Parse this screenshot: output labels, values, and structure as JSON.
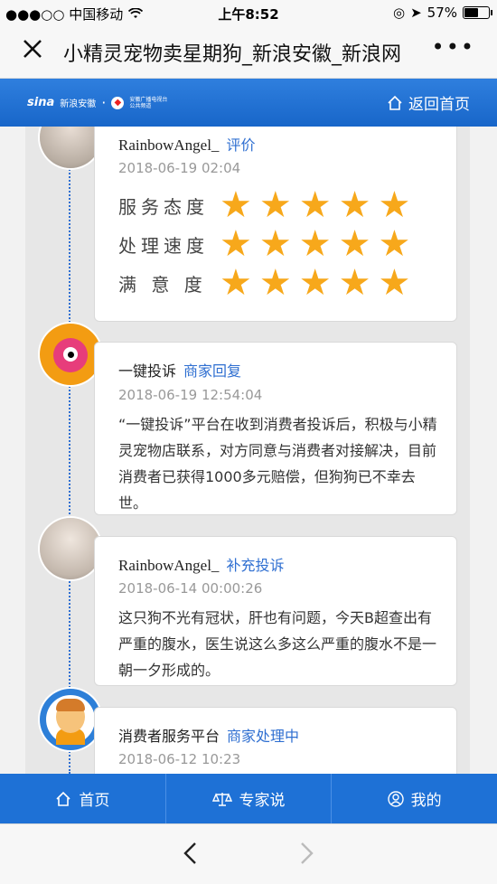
{
  "status_bar": {
    "carrier": "●●●○○ 中国移动",
    "wifi_icon": "wifi-icon",
    "time": "上午8:52",
    "battery": "57%"
  },
  "nav": {
    "close_icon": "close-icon",
    "title": "小精灵宠物卖星期狗_新浪安徽_新浪网",
    "more_icon": "more-icon"
  },
  "header": {
    "logo_sina": "sina",
    "logo_name": "新浪安徽",
    "logo_partner": "安徽广播电视台 公共频道",
    "home_label": "返回首页"
  },
  "entries": [
    {
      "author": "RainbowAngel_",
      "tag": "评价",
      "time": "2018-06-19 02:04",
      "ratings": [
        {
          "label": "服务态度",
          "stars": 5
        },
        {
          "label": "处理速度",
          "stars": 5
        },
        {
          "label": "满 意 度",
          "stars": 5
        }
      ]
    },
    {
      "author": "一键投诉",
      "tag": "商家回复",
      "time": "2018-06-19 12:54:04",
      "text": "“一键投诉”平台在收到消费者投诉后，积极与小精灵宠物店联系，对方同意与消费者对接解决，目前消费者已获得1000多元赔偿，但狗狗已不幸去世。"
    },
    {
      "author": "RainbowAngel_",
      "tag": "补充投诉",
      "time": "2018-06-14 00:00:26",
      "text": "这只狗不光有冠状，肝也有问题，今天B超查出有严重的腹水，医生说这么多这么严重的腹水不是一朝一夕形成的。"
    },
    {
      "author": "消费者服务平台",
      "tag": "商家处理中",
      "time": "2018-06-12 10:23"
    }
  ],
  "tabs": [
    {
      "label": "首页",
      "icon": "home-icon"
    },
    {
      "label": "专家说",
      "icon": "scale-icon"
    },
    {
      "label": "我的",
      "icon": "user-icon"
    }
  ],
  "browser": {
    "back_icon": "back-icon",
    "forward_icon": "forward-icon"
  },
  "colors": {
    "brand_blue": "#1e71d6",
    "star": "#f7a81b",
    "tag_blue": "#2f6fd1"
  }
}
